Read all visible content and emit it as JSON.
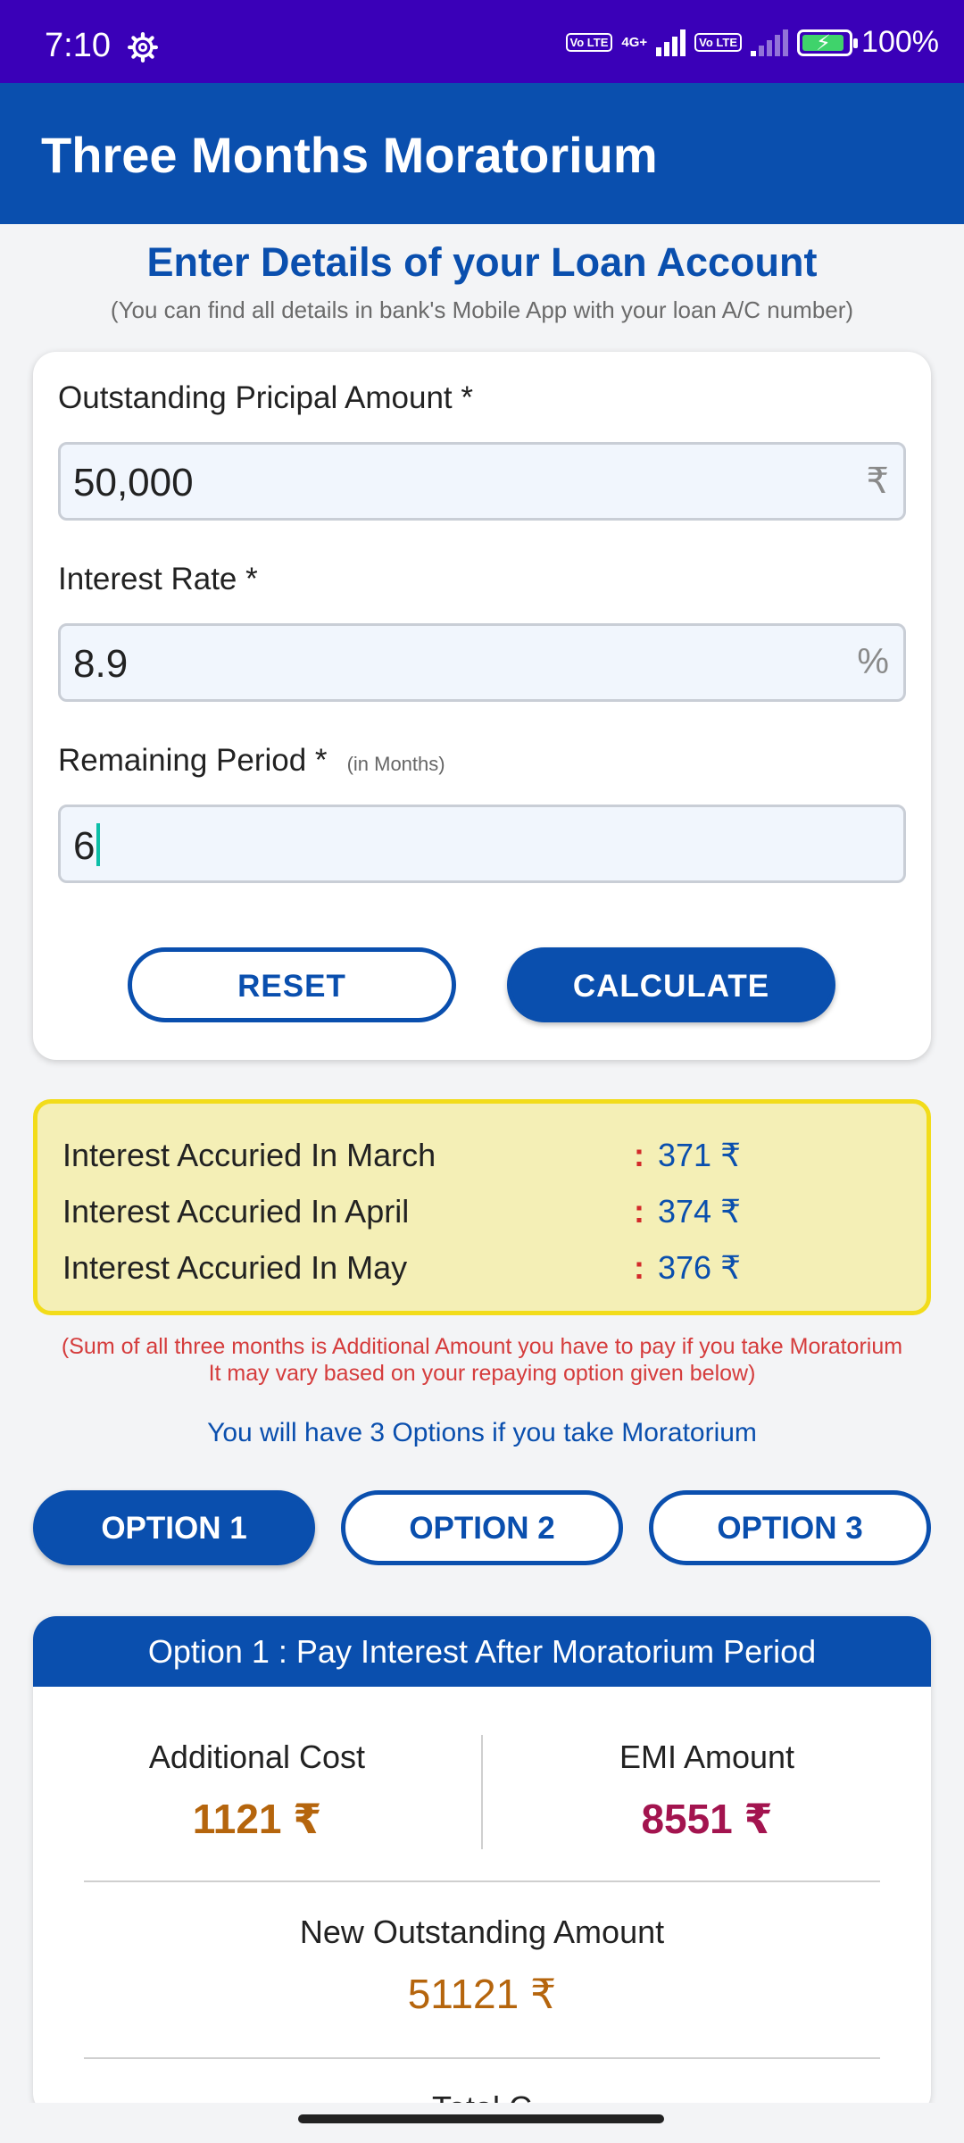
{
  "status_bar": {
    "time": "7:10",
    "network": "4G+",
    "volte": "Vo LTE",
    "battery": "100%"
  },
  "app_bar": {
    "title": "Three Months Moratorium"
  },
  "intro": {
    "title": "Enter Details of your Loan Account",
    "subtitle": "(You can find all details in bank's Mobile App with your loan A/C number)"
  },
  "form": {
    "principal": {
      "label": "Outstanding Pricipal Amount *",
      "value": "50,000",
      "unit": "₹"
    },
    "rate": {
      "label": "Interest Rate *",
      "value": "8.9",
      "unit": "%"
    },
    "period": {
      "label": "Remaining Period *",
      "hint": "(in Months)",
      "value": "6"
    },
    "reset_label": "RESET",
    "calculate_label": "CALCULATE"
  },
  "interest": {
    "rows": [
      {
        "label": "Interest Accuried In March",
        "value": "371  ₹"
      },
      {
        "label": "Interest Accuried In April",
        "value": "374  ₹"
      },
      {
        "label": "Interest Accuried In May",
        "value": "376  ₹"
      }
    ],
    "separator": ":"
  },
  "note": {
    "line1": "(Sum of all three months is Additional Amount you have to pay if you take Moratorium",
    "line2": "It may vary based on your repaying option given below)"
  },
  "options": {
    "heading": "You will have 3 Options if you take Moratorium",
    "items": [
      "OPTION 1",
      "OPTION 2",
      "OPTION 3"
    ]
  },
  "result": {
    "title": "Option 1 : Pay Interest After Moratorium Period",
    "additional_cost": {
      "label": "Additional Cost",
      "value": "1121  ₹"
    },
    "emi_amount": {
      "label": "EMI Amount",
      "value": "8551  ₹"
    },
    "new_outstanding": {
      "label": "New Outstanding Amount",
      "value": "51121  ₹"
    },
    "next_label_partial": "Total C"
  },
  "colors": {
    "status_bar": "#3a00b8",
    "primary": "#0a4fae",
    "highlight_bg": "#f4efb6",
    "highlight_border": "#f2dc1a",
    "note_red": "#d53c3c",
    "cost_orange": "#b5650d",
    "emi_maroon": "#a3144f"
  }
}
